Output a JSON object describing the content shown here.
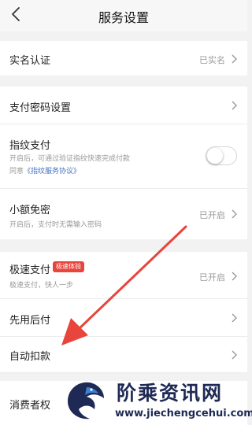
{
  "header": {
    "title": "服务设置"
  },
  "rows": {
    "real_name": {
      "title": "实名认证",
      "value": "已实名"
    },
    "pay_password": {
      "title": "支付密码设置"
    },
    "fingerprint": {
      "title": "指纹支付",
      "sub1": "开启后，可通过验证指纹快速完成付款",
      "sub2_prefix": "同意",
      "sub2_link": "《指纹服务协议》",
      "enabled": false
    },
    "small_free": {
      "title": "小额免密",
      "sub": "开启后，支付时无需输入密码",
      "value": "已开启"
    },
    "fast_pay": {
      "title": "极速支付",
      "badge": "极速体验",
      "sub": "极速支付，快人一步",
      "value": "已开启"
    },
    "pay_later": {
      "title": "先用后付"
    },
    "auto_deduct": {
      "title": "自动扣款"
    },
    "consumer": {
      "title": "消费者权"
    }
  },
  "watermark": {
    "brand": "阶乘资讯网",
    "url": "www.jiechengcehui.com"
  },
  "colors": {
    "badge": "#e8453c",
    "link": "#4472c4",
    "arrow": "#e8453c",
    "watermark": "#1e2a55"
  }
}
